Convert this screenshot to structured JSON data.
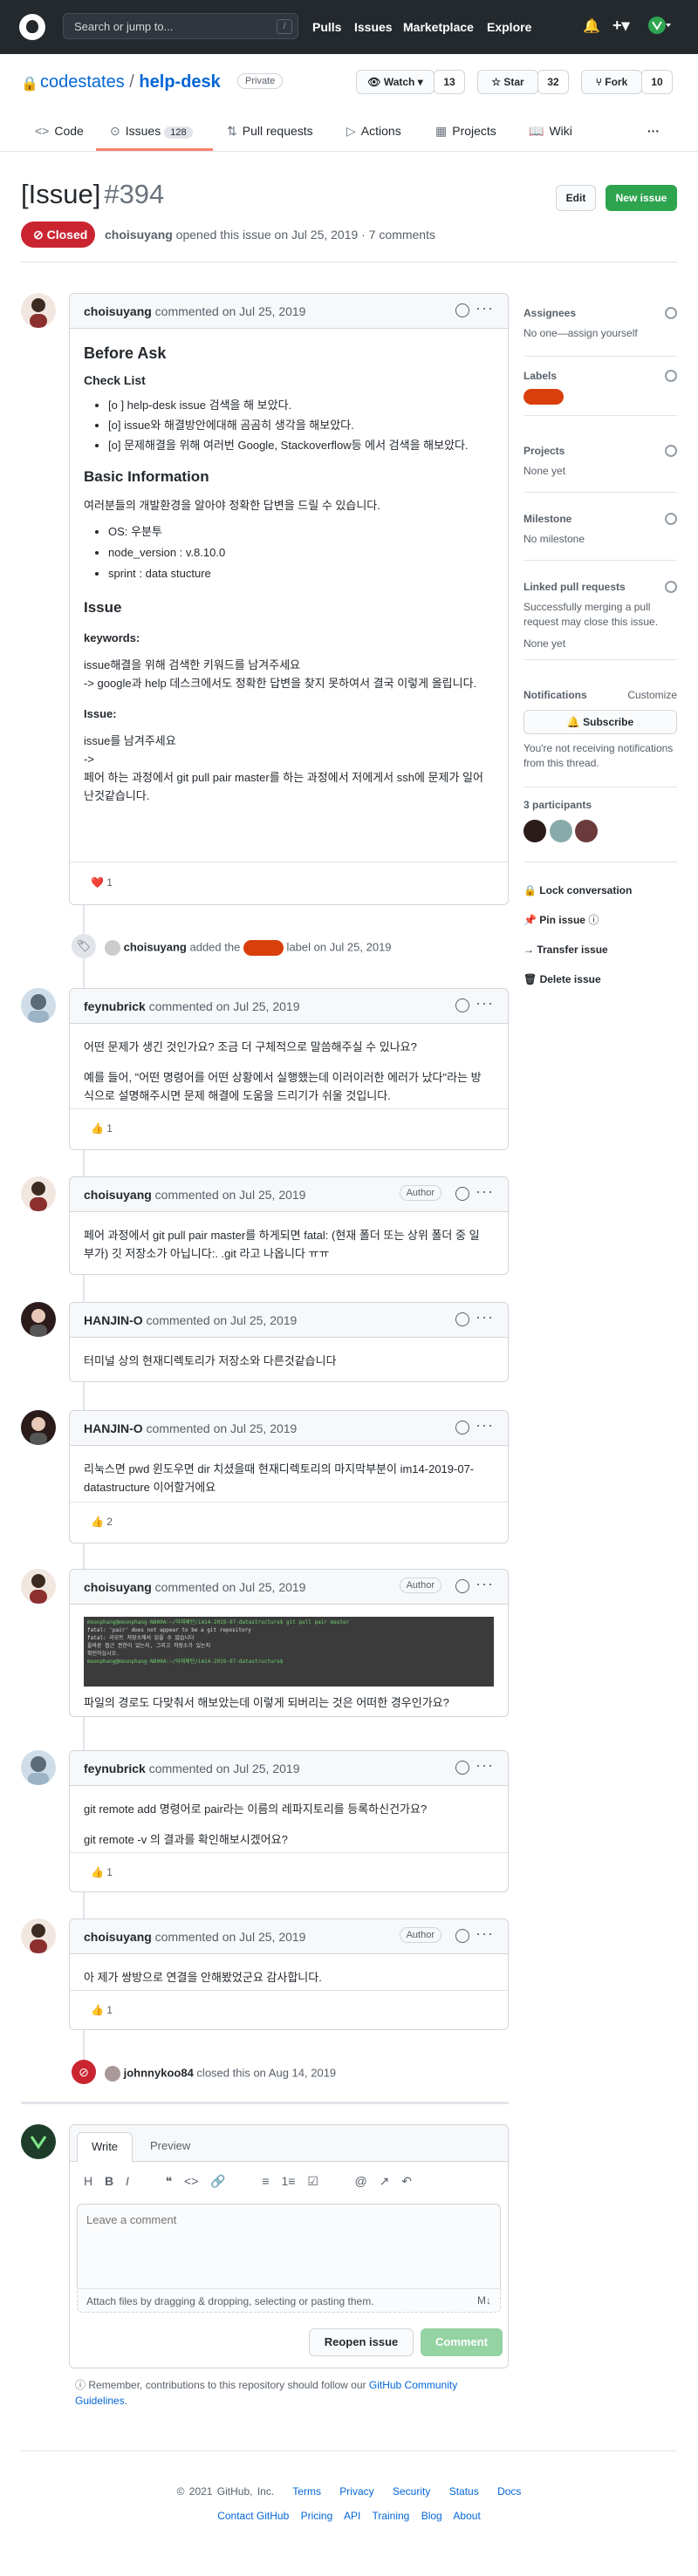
{
  "header": {
    "search_placeholder": "Search or jump to...",
    "slash": "/",
    "nav": [
      "Pulls",
      "Issues",
      "Marketplace",
      "Explore"
    ]
  },
  "repo": {
    "owner": "codestates",
    "sep": "/",
    "name": "help-desk",
    "visibility": "Private",
    "watch": {
      "label": "Watch",
      "count": "13"
    },
    "star": {
      "label": "Star",
      "count": "32"
    },
    "fork": {
      "label": "Fork",
      "count": "10"
    }
  },
  "tabs": [
    {
      "label": "Code"
    },
    {
      "label": "Issues",
      "count": "128"
    },
    {
      "label": "Pull requests"
    },
    {
      "label": "Actions"
    },
    {
      "label": "Projects"
    },
    {
      "label": "Wiki"
    },
    {
      "label": "···"
    }
  ],
  "issue": {
    "title": "[Issue]",
    "number": "#394",
    "edit": "Edit",
    "new_issue": "New issue",
    "state": "Closed",
    "meta_user": "choisuyang",
    "meta_rest": " opened this issue on Jul 25, 2019 · 7 comments"
  },
  "first_comment": {
    "user": "choisuyang",
    "date": " commented on Jul 25, 2019",
    "h_before": "Before Ask",
    "h_check": "Check List",
    "checks": [
      "[o ] help-desk issue 검색을 해 보았다.",
      "[o] issue와 해결방안에대해 곰곰히 생각을 해보았다.",
      "[o] 문제해결을 위해 여러번 Google, Stackoverflow등 에서 검색을 해보았다."
    ],
    "h_basic": "Basic Information",
    "basic_intro": "여러분들의 개발환경을 알아야 정확한 답변을 드릴 수 있습니다.",
    "basic": [
      "OS: 우분투",
      "node_version : v.8.10.0",
      "sprint : data stucture"
    ],
    "h_issue": "Issue",
    "kw_label": "keywords:",
    "kw1": "issue해결을 위해 검색한 키워드를 남겨주세요",
    "kw2": "-> google과 help 데스크에서도 정확한 답변을 찾지 못하여서 결국 이렇게 올립니다.",
    "issue_label": "Issue:",
    "issue1": "issue를 남겨주세요",
    "issue2": "->",
    "issue3": "페어 하는 과정에서 git pull pair master를 하는 과정에서 저에게서 ssh에 문제가 일어",
    "issue4": "난것같습니다.",
    "reaction": "❤️  1"
  },
  "label_event": {
    "user": "choisuyang",
    "pre": " added the ",
    "post": " label on Jul 25, 2019"
  },
  "comments": [
    {
      "user": "feynubrick",
      "date": " commented on Jul 25, 2019",
      "p1": "어떤 문제가 생긴 것인가요? 조금 더 구체적으로 말씀해주실 수 있나요?",
      "p2": "예를 들어, \"어떤 명령어를 어떤 상황에서 실행했는데 이러이러한 에러가 났다\"라는 방",
      "p3": "식으로 설명해주시면 문제 해결에 도움을 드리기가 쉬울 것입니다.",
      "reaction": "👍  1"
    },
    {
      "user": "choisuyang",
      "date": " commented on Jul 25, 2019",
      "author": "Author",
      "p1": "페어 과정에서 git pull pair master를 하게되면 fatal: (현재 폴더 또는 상위 폴더 중 일",
      "p2": "부가) 깃 저장소가 아닙니다:. .git 라고 나옵니다 ㅠㅠ"
    },
    {
      "user": "HANJIN-O",
      "date": " commented on Jul 25, 2019",
      "p1": "터미널 상의 현재디렉토리가 저장소와 다른것같습니다"
    },
    {
      "user": "HANJIN-O",
      "date": " commented on Jul 25, 2019",
      "p1": "리눅스면 pwd 윈도우면 dir 치셨을때 현재디렉토리의 마지막부분이 im14-2019-07-",
      "p2": "datastructure 이어할거에요",
      "reaction": "👍  2"
    },
    {
      "user": "choisuyang",
      "date": " commented on Jul 25, 2019",
      "author": "Author",
      "term": [
        "moonphang@moonphang-N800A:~/미래패턴/im14-2019-07-datastructure$ git pull pair master",
        "fatal: 'pair' does not appear to be a git repository",
        "fatal: 리모트 저장소에서 읽을 수 없습니다",
        "",
        "올바른 접근 권한이 있는지, 그리고 저장소가 있는지",
        "확인하십시오.",
        "moonphang@moonphang-N800A:~/미래패턴/im14-2019-07-datastructure$ "
      ],
      "p1": "파일의 경로도 다맞춰서 해보았는데 이렇게 되버리는 것은 어떠한 경우인가요?"
    },
    {
      "user": "feynubrick",
      "date": " commented on Jul 25, 2019",
      "p1": "git remote add 명령어로 pair라는 이름의 레파지토리를 등록하신건가요?",
      "p2": "git remote -v 의 결과를 확인해보시겠어요?",
      "reaction": "👍  1"
    },
    {
      "user": "choisuyang",
      "date": " commented on Jul 25, 2019",
      "author": "Author",
      "p1": "아 제가 쌍방으로 연결을 안해봤었군요 감사합니다.",
      "reaction": "👍  1"
    }
  ],
  "close_event": {
    "user": "johnnykoo84",
    "rest": " closed this on Aug 14, 2019"
  },
  "editor": {
    "write": "Write",
    "preview": "Preview",
    "placeholder": "Leave a comment",
    "attach": "Attach files by dragging & dropping, selecting or pasting them.",
    "reopen": "Reopen issue",
    "comment": "Comment",
    "toolbar": [
      "H",
      "B",
      "I",
      "❝",
      "<>",
      "🔗",
      "≡",
      "1≡",
      "☑",
      "@",
      "↗",
      "↶"
    ]
  },
  "notice": {
    "text": "Remember, contributions to this repository should follow our ",
    "link": "GitHub Community",
    "link2": "Guidelines",
    "end": "."
  },
  "sidebar": {
    "assignees": "Assignees",
    "assignees_v": "No one—assign yourself",
    "labels": "Labels",
    "projects": "Projects",
    "projects_v": "None yet",
    "milestone": "Milestone",
    "milestone_v": "No milestone",
    "linked": "Linked pull requests",
    "linked_v": "Successfully merging a pull request may close this issue.",
    "linked_v2": "None yet",
    "notif": "Notifications",
    "customize": "Customize",
    "subscribe": "Subscribe",
    "notif_v": "You're not receiving notifications from this thread.",
    "participants": "3 participants",
    "lock": "Lock conversation",
    "pin": "Pin issue",
    "transfer": "Transfer issue",
    "delete": "Delete issue"
  },
  "footer": {
    "copyright": "© 2021 GitHub, Inc.",
    "row1": [
      "Terms",
      "Privacy",
      "Security",
      "Status",
      "Docs"
    ],
    "row2": [
      "Contact GitHub",
      "Pricing",
      "API",
      "Training",
      "Blog",
      "About"
    ]
  },
  "colors": {
    "header": "#24292e",
    "closed": "#cb2431",
    "green": "#2ea44f",
    "link": "#0366d6",
    "label": "#d93f0b"
  }
}
